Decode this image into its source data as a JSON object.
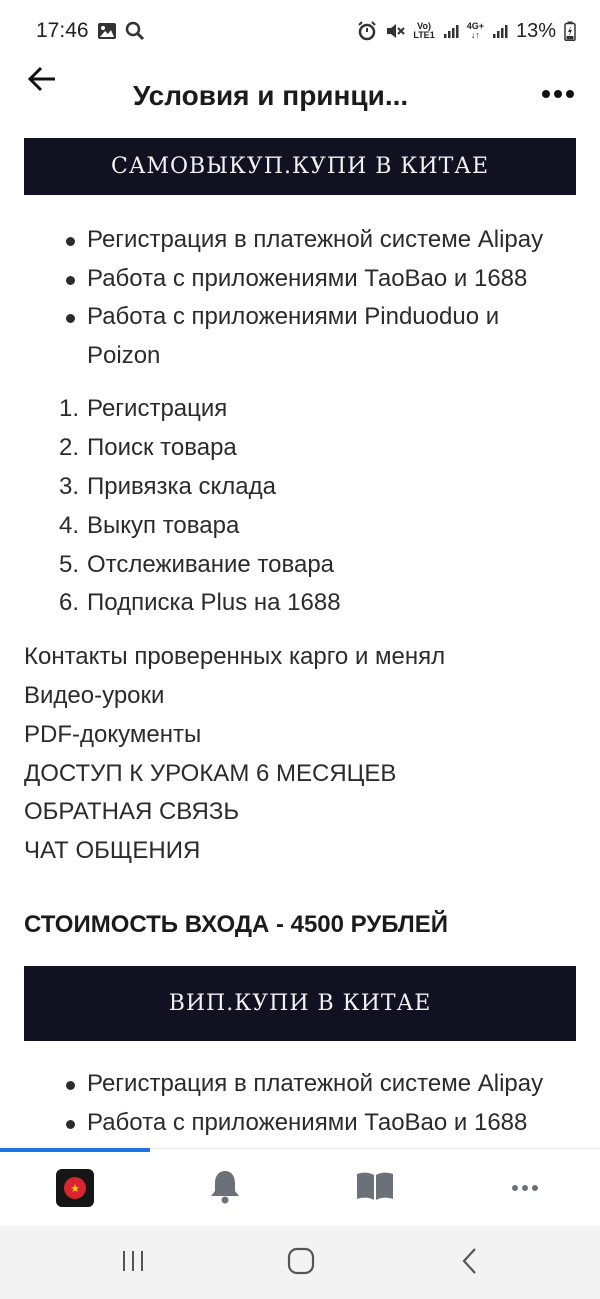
{
  "status_bar": {
    "time": "17:46",
    "battery": "13%",
    "volte_top": "Vo)",
    "volte_bottom": "LTE1",
    "net_top": "4G+",
    "icons": [
      "gallery-icon",
      "search-icon",
      "alarm-icon",
      "mute-icon",
      "volte-icon",
      "signal-icon",
      "network-icon",
      "signal-icon",
      "battery-charging-icon"
    ]
  },
  "header": {
    "title": "Условия и принци...",
    "back_icon": "arrow-left-icon",
    "more_icon": "more-horizontal-icon"
  },
  "section1": {
    "banner": "САМОВЫКУП.КУПИ В КИТАЕ",
    "bullets": [
      "Регистрация в платежной системе Alipay",
      "Работа с приложениями ТаоВао и 1688",
      "Работа с приложениями Pinduoduo и Poizon"
    ],
    "steps": [
      {
        "num": "1.",
        "text": "Регистрация"
      },
      {
        "num": "2.",
        "text": "Поиск товара"
      },
      {
        "num": "3.",
        "text": "Привязка склада"
      },
      {
        "num": "4.",
        "text": "Выкуп товара"
      },
      {
        "num": "5.",
        "text": "Отслеживание товара"
      },
      {
        "num": "6.",
        "text": "Подписка Plus на 1688"
      }
    ],
    "features": [
      "Контакты проверенных карго и менял",
      "Видео-уроки",
      "PDF-документы",
      "ДОСТУП К УРОКАМ 6 МЕСЯЦЕВ",
      "ОБРАТНАЯ СВЯЗЬ",
      "ЧАТ ОБЩЕНИЯ"
    ],
    "price": "СТОИМОСТЬ ВХОДА - 4500 РУБЛЕЙ"
  },
  "section2": {
    "banner": "ВИП.КУПИ В КИТАЕ",
    "bullets": [
      "Регистрация в платежной системе Alipay",
      "Работа с приложениями ТаоВао и 1688"
    ]
  },
  "bottom_nav": {
    "items": [
      "app-thumbnail",
      "bell-icon",
      "book-icon",
      "more-icon"
    ],
    "active_index": 0
  },
  "system_nav": {
    "items": [
      "recent-apps-icon",
      "home-icon",
      "back-icon"
    ]
  },
  "colors": {
    "banner_bg": "#111122",
    "banner_text": "#f2f2f2",
    "accent": "#1f73e0",
    "text": "#2b2b2b"
  }
}
